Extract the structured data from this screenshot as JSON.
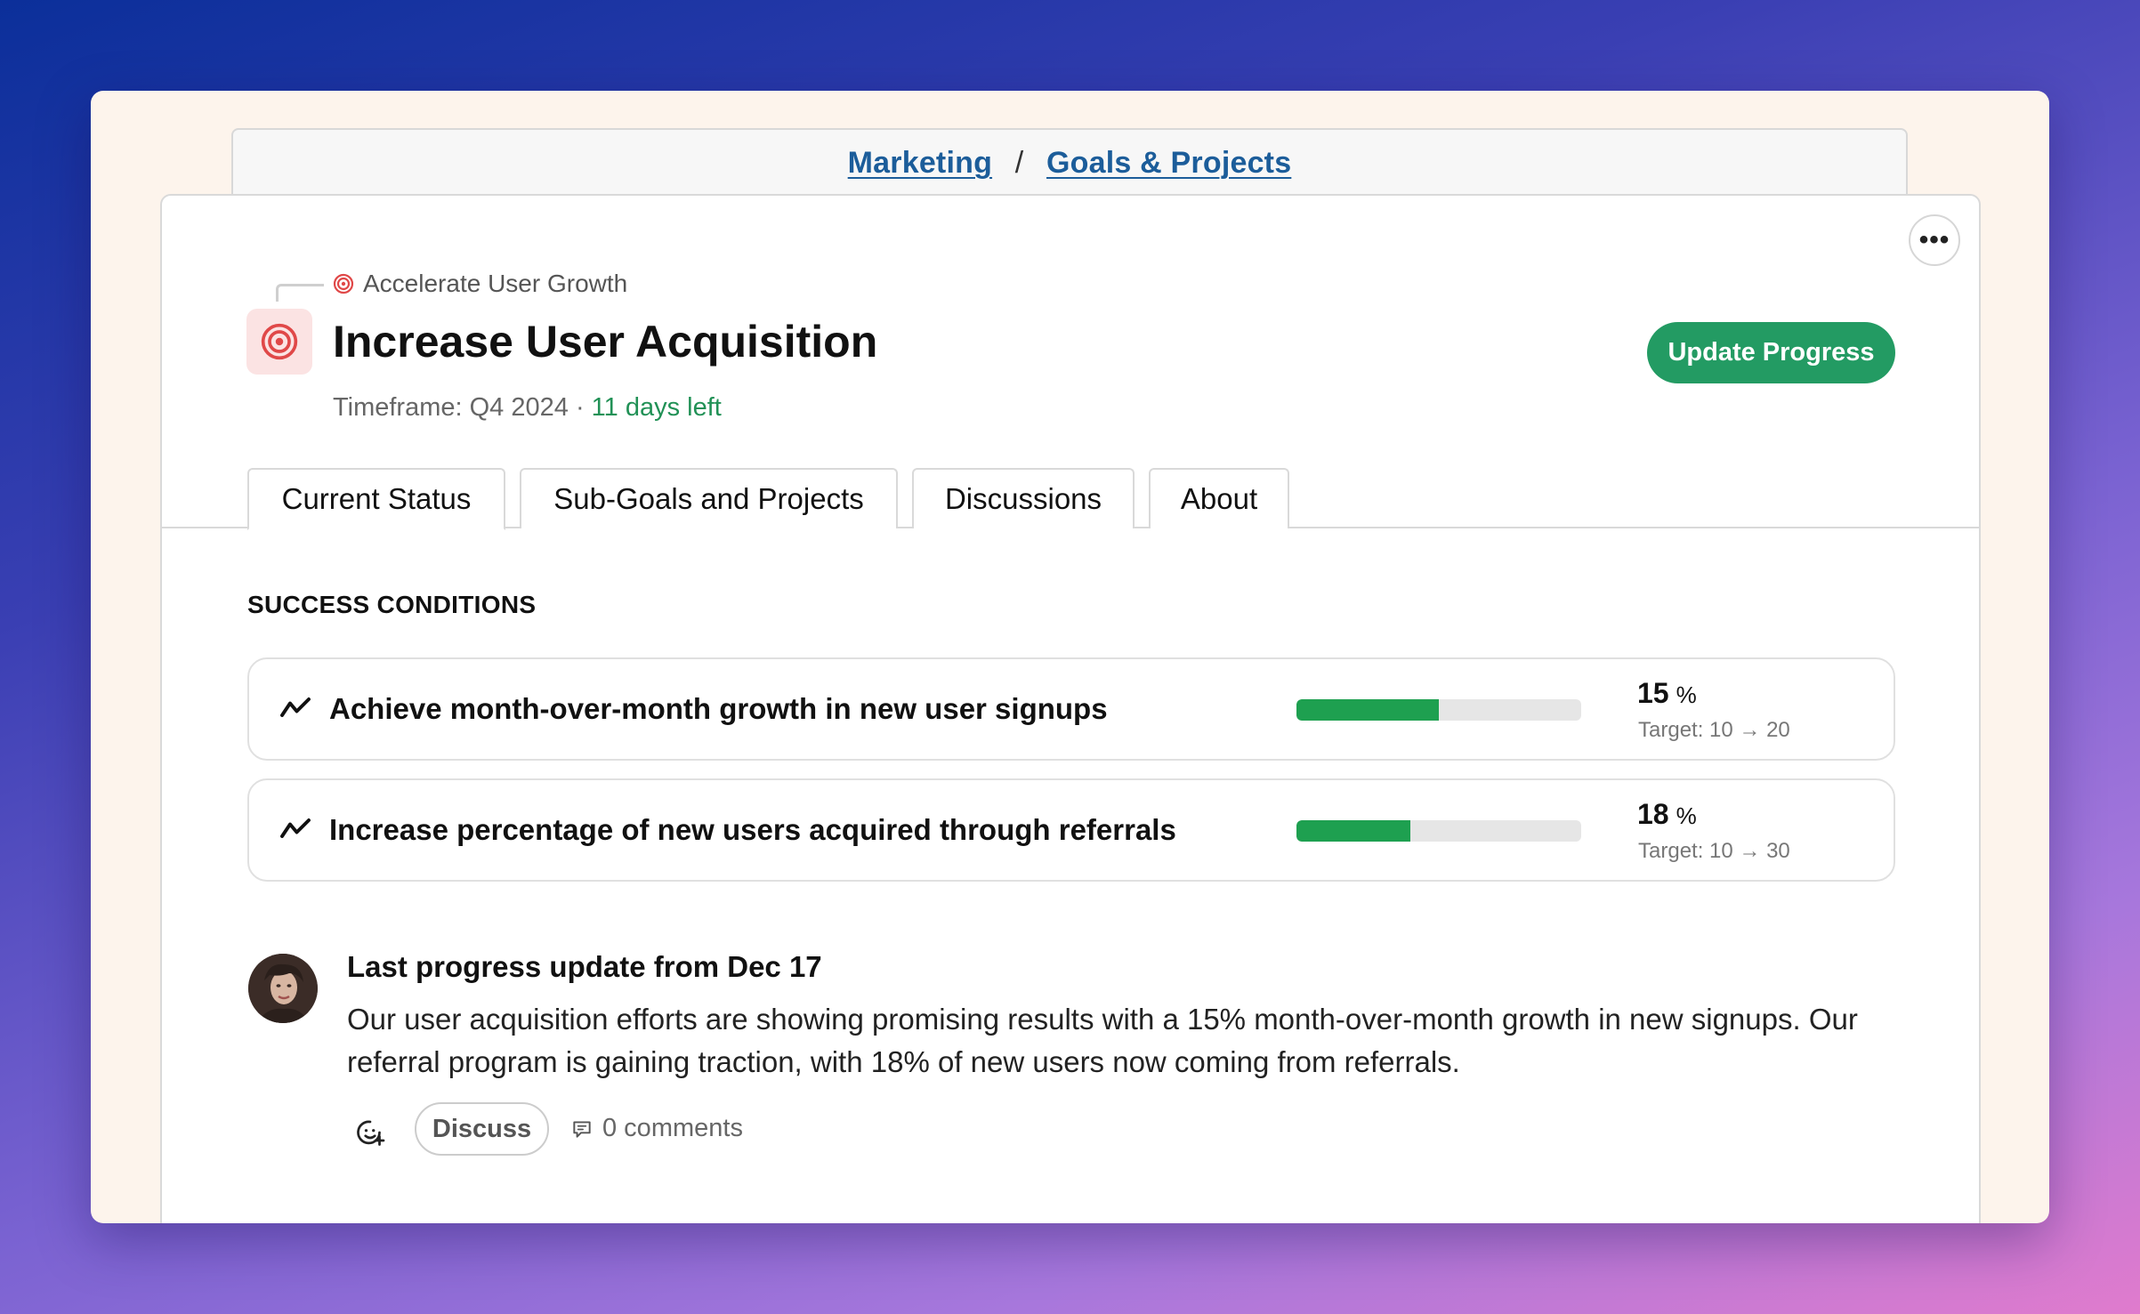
{
  "breadcrumb": {
    "items": [
      "Marketing",
      "Goals & Projects"
    ],
    "separator": "/"
  },
  "goal": {
    "parent_label": "Accelerate User Growth",
    "title": "Increase User Acquisition",
    "timeframe_label": "Timeframe: Q4 2024",
    "timeframe_sep": "·",
    "days_left": "11 days left",
    "update_button": "Update Progress",
    "more_button": "•••",
    "icon": "target-icon"
  },
  "tabs": [
    {
      "label": "Current Status",
      "active": true
    },
    {
      "label": "Sub-Goals and Projects",
      "active": false
    },
    {
      "label": "Discussions",
      "active": false
    },
    {
      "label": "About",
      "active": false
    }
  ],
  "success": {
    "section_title": "SUCCESS CONDITIONS",
    "conditions": [
      {
        "text": "Achieve month-over-month growth in new user signups",
        "value": "15",
        "unit": "%",
        "target_label": "Target: 10 → 20",
        "progress": 0.5
      },
      {
        "text": "Increase percentage of new users acquired through referrals",
        "value": "18",
        "unit": "%",
        "target_label": "Target: 10 → 30",
        "progress": 0.4
      }
    ]
  },
  "update": {
    "title": "Last progress update from Dec 17",
    "body": "Our user acquisition efforts are showing promising results with a 15% month-over-month growth in new signups. Our referral program is gaining traction, with 18% of new users now coming from referrals.",
    "discuss_label": "Discuss",
    "comments_label": "0 comments"
  },
  "colors": {
    "accent_green": "#239b63",
    "progress_green": "#1ea050",
    "link_blue": "#1c5d9a",
    "target_red": "#e04848"
  }
}
